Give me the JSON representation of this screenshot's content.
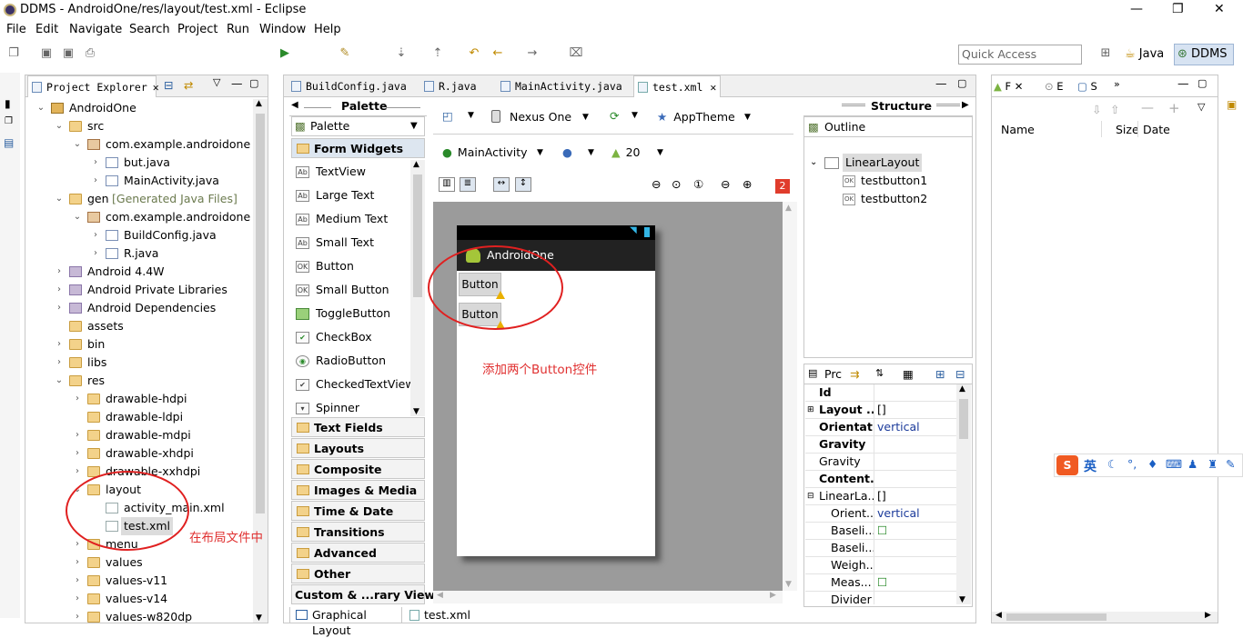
{
  "window": {
    "title": "DDMS - AndroidOne/res/layout/test.xml - Eclipse",
    "controls": {
      "minimize": "—",
      "maximize": "❐",
      "close": "✕"
    }
  },
  "menu": [
    "File",
    "Edit",
    "Navigate",
    "Search",
    "Project",
    "Run",
    "Window",
    "Help"
  ],
  "toolbar": {
    "quick_access_placeholder": "Quick Access",
    "perspectives": [
      "Java",
      "DDMS"
    ]
  },
  "project_explorer": {
    "tab_label": "Project Explorer",
    "items": [
      {
        "label": "AndroidOne"
      },
      {
        "label": "src"
      },
      {
        "label": "com.example.androidone"
      },
      {
        "label": "but.java"
      },
      {
        "label": "MainActivity.java"
      },
      {
        "label": "gen",
        "suffix": "[Generated Java Files]"
      },
      {
        "label": "com.example.androidone"
      },
      {
        "label": "BuildConfig.java"
      },
      {
        "label": "R.java"
      },
      {
        "label": "Android 4.4W"
      },
      {
        "label": "Android Private Libraries"
      },
      {
        "label": "Android Dependencies"
      },
      {
        "label": "assets"
      },
      {
        "label": "bin"
      },
      {
        "label": "libs"
      },
      {
        "label": "res"
      },
      {
        "label": "drawable-hdpi"
      },
      {
        "label": "drawable-ldpi"
      },
      {
        "label": "drawable-mdpi"
      },
      {
        "label": "drawable-xhdpi"
      },
      {
        "label": "drawable-xxhdpi"
      },
      {
        "label": "layout"
      },
      {
        "label": "activity_main.xml"
      },
      {
        "label": "test.xml"
      },
      {
        "label": "menu"
      },
      {
        "label": "values"
      },
      {
        "label": "values-v11"
      },
      {
        "label": "values-v14"
      },
      {
        "label": "values-w820dp"
      }
    ]
  },
  "editor_tabs": [
    "BuildConfig.java",
    "R.java",
    "MainActivity.java",
    "test.xml"
  ],
  "palette": {
    "header": "Palette",
    "dropdown_label": "Palette",
    "open_category": "Form Widgets",
    "widgets": [
      {
        "icon": "Ab",
        "label": "TextView"
      },
      {
        "icon": "Ab",
        "label": "Large Text"
      },
      {
        "icon": "Ab",
        "label": "Medium Text"
      },
      {
        "icon": "Ab",
        "label": "Small Text"
      },
      {
        "icon": "OK",
        "label": "Button"
      },
      {
        "icon": "OK",
        "label": "Small Button"
      },
      {
        "icon": "",
        "label": "ToggleButton"
      },
      {
        "icon": "✔",
        "label": "CheckBox"
      },
      {
        "icon": "◉",
        "label": "RadioButton"
      },
      {
        "icon": "✔",
        "label": "CheckedTextView"
      },
      {
        "icon": "▾",
        "label": "Spinner"
      }
    ],
    "categories": [
      "Text Fields",
      "Layouts",
      "Composite",
      "Images & Media",
      "Time & Date",
      "Transitions",
      "Advanced",
      "Other",
      "Custom & ...rary Views"
    ]
  },
  "canvas_toolbar": {
    "device": "Nexus One",
    "theme": "AppTheme",
    "activity": "MainActivity",
    "api": "20",
    "error_count": "2"
  },
  "device": {
    "app_title": "AndroidOne",
    "buttons": [
      "Button",
      "Button"
    ]
  },
  "annotations": {
    "canvas_note": "添加两个Button控件",
    "explorer_note": "在布局文件中"
  },
  "bottom_tabs": [
    "Graphical Layout",
    "test.xml"
  ],
  "structure": {
    "header": "Structure",
    "outline_label": "Outline",
    "nodes": [
      {
        "label": "LinearLayout"
      },
      {
        "label": "testbutton1"
      },
      {
        "label": "testbutton2"
      }
    ]
  },
  "properties": {
    "tab_label": "Prc",
    "rows": [
      {
        "key": "Id",
        "value": "",
        "bold": true
      },
      {
        "key": "Layout ...",
        "value": "[]",
        "bold": true
      },
      {
        "key": "Orientat...",
        "value": "vertical",
        "bold": true
      },
      {
        "key": "Gravity",
        "value": "",
        "bold": true
      },
      {
        "key": "Gravity",
        "value": "",
        "bold": false
      },
      {
        "key": "Content...",
        "value": "",
        "bold": true
      },
      {
        "key": "LinearLa...",
        "value": "[]",
        "bold": false
      },
      {
        "key": "Orient...",
        "value": "vertical",
        "bold": false
      },
      {
        "key": "Baseli...",
        "value": "☐",
        "bold": false
      },
      {
        "key": "Baseli...",
        "value": "",
        "bold": false
      },
      {
        "key": "Weigh...",
        "value": "",
        "bold": false
      },
      {
        "key": "Meas...",
        "value": "☐",
        "bold": false
      },
      {
        "key": "Divider",
        "value": "",
        "bold": false
      }
    ]
  },
  "file_explorer": {
    "tab_labels": [
      "F",
      "E",
      "S"
    ],
    "columns": [
      "Name",
      "Size",
      "Date"
    ]
  },
  "ime": {
    "label": "英"
  },
  "colors": {
    "annotation_red": "#e02020",
    "accent_blue": "#1b3a9a"
  }
}
